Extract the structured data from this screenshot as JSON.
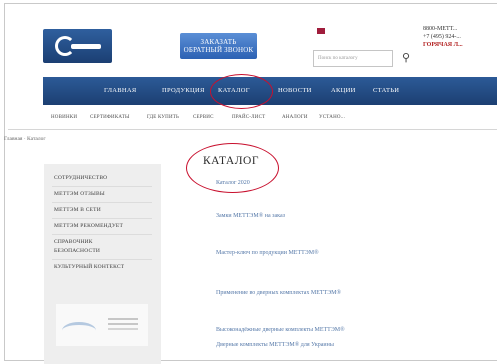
{
  "header": {
    "callback_line1": "ЗАКАЗАТЬ",
    "callback_line2": "ОБРАТНЫЙ ЗВОНОК",
    "search_placeholder": "Поиск по каталогу",
    "phone_line1": "8800-МЕТТ...",
    "phone_line2": "+7 (495) 924-...",
    "hotline": "ГОРЯЧАЯ Л..."
  },
  "mainnav": {
    "items": [
      "ГЛАВНАЯ",
      "ПРОДУКЦИЯ",
      "КАТАЛОГ",
      "НОВОСТИ",
      "АКЦИИ",
      "СТАТЬИ"
    ]
  },
  "subnav": {
    "items": [
      "НОВИНКИ",
      "СЕРТИФИКАТЫ",
      "ГДЕ КУПИТЬ",
      "СЕРВИС",
      "ПРАЙС-ЛИСТ",
      "АНАЛОГИ",
      "УСТАНО..."
    ]
  },
  "breadcrumb": "Главная · Каталог",
  "sidebar": {
    "items": [
      "СОТРУДНИЧЕСТВО",
      "МЕТТЭМ ОТЗЫВЫ",
      "МЕТТЭМ В СЕТИ",
      "МЕТТЭМ РЕКОМЕНДУЕТ",
      "СПРАВОЧНИК",
      "БЕЗОПАСНОСТИ",
      "КУЛЬТУРНЫЙ КОНТЕКСТ"
    ]
  },
  "content": {
    "title": "КАТАЛОГ",
    "links": [
      "Каталог 2020",
      "Замки МЕТТЭМ® на заказ",
      "Мастер-ключ по продукции МЕТТЭМ®",
      "Применение во дверных комплектах МЕТТЭМ®",
      "Высоконадёжные дверные комплекты МЕТТЭМ®",
      "Дверные комплекты МЕТТЭМ® для Украины"
    ]
  },
  "colors": {
    "nav_bg": "#23497f",
    "highlight_oval": "#c8102e",
    "link": "#5578a8"
  },
  "icons": {
    "search": "magnifier-icon",
    "logo": "metteam-logo",
    "flag": "language-flag-icon"
  }
}
